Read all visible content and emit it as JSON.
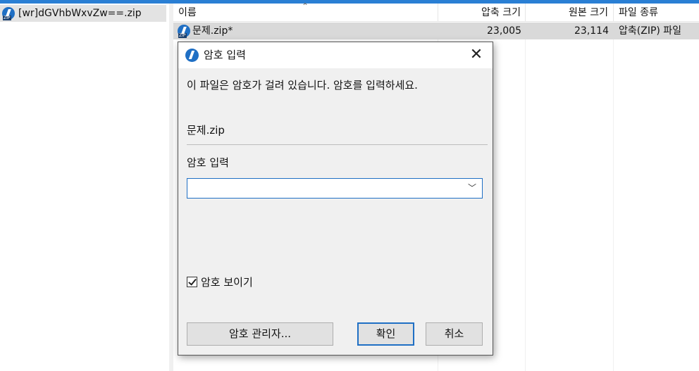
{
  "tree": {
    "item_label": "[wr]dGVhbWxvZw==.zip"
  },
  "list": {
    "columns": [
      "이름",
      "압축 크기",
      "원본 크기",
      "파일 종류"
    ],
    "rows": [
      {
        "name": "문제.zip*",
        "compressed": "23,005",
        "original": "23,114",
        "type": "압축(ZIP) 파일"
      }
    ]
  },
  "dialog": {
    "title": "암호 입력",
    "close_glyph": "✕",
    "message": "이 파일은 암호가 걸려 있습니다. 암호를 입력하세요.",
    "file_name": "문제.zip",
    "password_label": "암호 입력",
    "password_value": "",
    "show_password_label": "암호 보이기",
    "show_password_checked": true,
    "buttons": {
      "manager": "암호 관리자...",
      "ok": "확인",
      "cancel": "취소"
    }
  },
  "colors": {
    "accent": "#1f6fc4",
    "selection": "#d9d9d9",
    "dialog_bg": "#f0f0f0"
  }
}
